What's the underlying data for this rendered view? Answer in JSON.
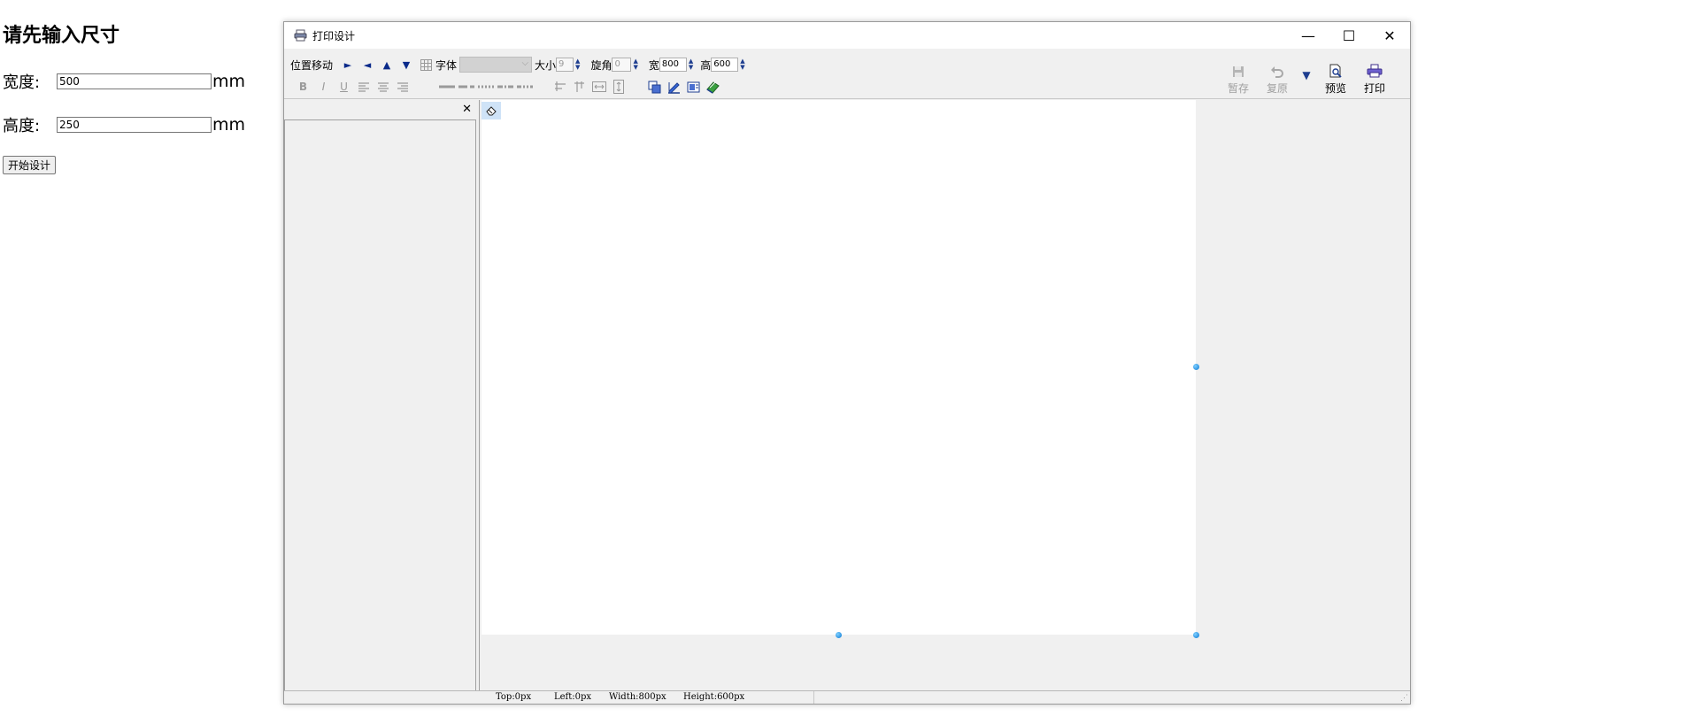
{
  "form": {
    "title": "请先输入尺寸",
    "width_label": "宽度:",
    "width_value": "500",
    "height_label": "高度:",
    "height_value": "250",
    "unit": "mm",
    "start_button": "开始设计"
  },
  "window": {
    "title": "打印设计",
    "minimize": "—",
    "maximize": "☐",
    "close": "✕"
  },
  "toolbar": {
    "move_label": "位置移动",
    "arrow_right": "►",
    "arrow_left": "◄",
    "arrow_up": "▲",
    "arrow_down": "▼",
    "font_label": "字体",
    "size_label": "大小",
    "size_value": "9",
    "rotate_label": "旋角",
    "rotate_value": "0",
    "width_label": "宽",
    "width_value": "800",
    "height_label": "高",
    "height_value": "600",
    "bold": "B",
    "italic": "I",
    "underline": "U",
    "save_label": "暂存",
    "restore_label": "复原",
    "dropdown_arrow": "▼",
    "preview_label": "预览",
    "print_label": "打印"
  },
  "left_panel": {
    "close": "✕"
  },
  "status": {
    "top": "Top:0px",
    "left": "Left:0px",
    "width": "Width:800px",
    "height": "Height:600px"
  },
  "colors": {
    "accent": "#0a78d4",
    "window_bg": "#f0f0f0",
    "paper": "#ffffff"
  }
}
